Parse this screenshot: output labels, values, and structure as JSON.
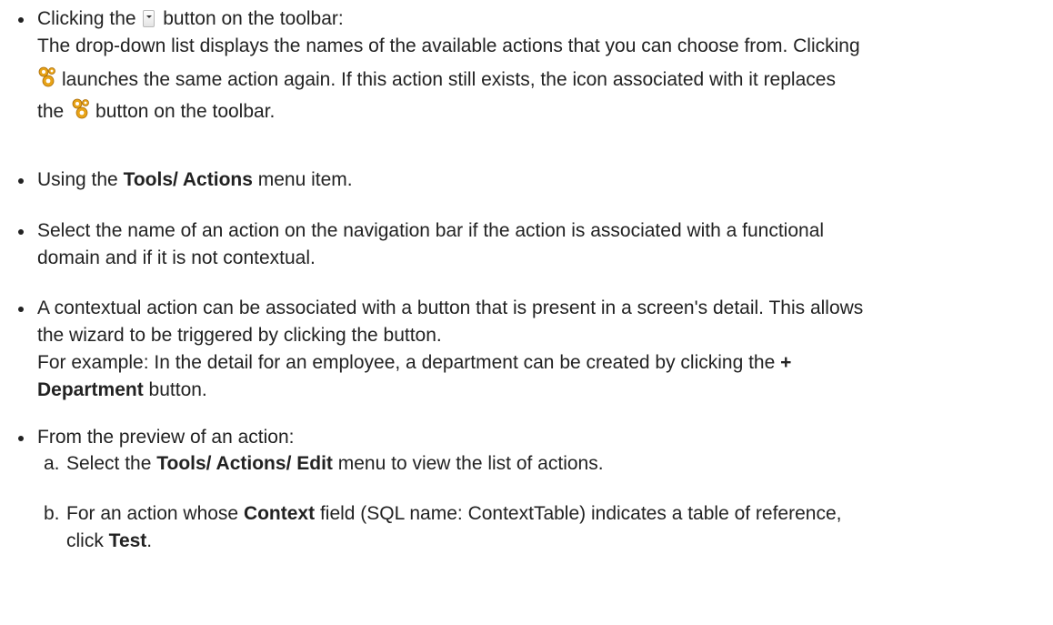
{
  "bullets": {
    "b1": {
      "l1_pre": "Clicking the",
      "l1_post": "button on the toolbar:",
      "l2": "The drop-down list displays the names of the available actions that you can choose from. Clicking",
      "l3": "launches the same action again. If this action still exists, the icon associated with it replaces",
      "l4_pre": "the",
      "l4_post": "button on the toolbar."
    },
    "b2": {
      "pre": "Using the ",
      "bold": "Tools/ Actions",
      "post": " menu item."
    },
    "b3": {
      "l1": "Select the name of an action on the navigation bar if the action is associated with a functional",
      "l2": "domain and if it is not contextual."
    },
    "b4": {
      "l1": "A contextual action can be associated with a button that is present in a screen's detail. This allows",
      "l2": "the wizard to be triggered by clicking the button.",
      "l3_pre": "For example: In the detail for an employee, a department can be created by clicking the ",
      "l3_bold": "+",
      "l4_bold": "Department",
      "l4_post": " button."
    },
    "b5": {
      "l1": "From the preview of an action:",
      "a_label": "a.",
      "a_pre": "Select the ",
      "a_bold": "Tools/ Actions/ Edit",
      "a_post": " menu to view the list of actions.",
      "b_label": "b.",
      "b_pre": "For an action whose ",
      "b_bold": "Context",
      "b_post": " field (SQL name: ContextTable) indicates a table of reference,",
      "b_l2_pre": "click ",
      "b_l2_bold": "Test",
      "b_l2_post": "."
    }
  },
  "icons": {
    "dropdown": "dropdown-arrow-icon",
    "actions": "gears-icon",
    "gear_color": "#e8a317"
  }
}
